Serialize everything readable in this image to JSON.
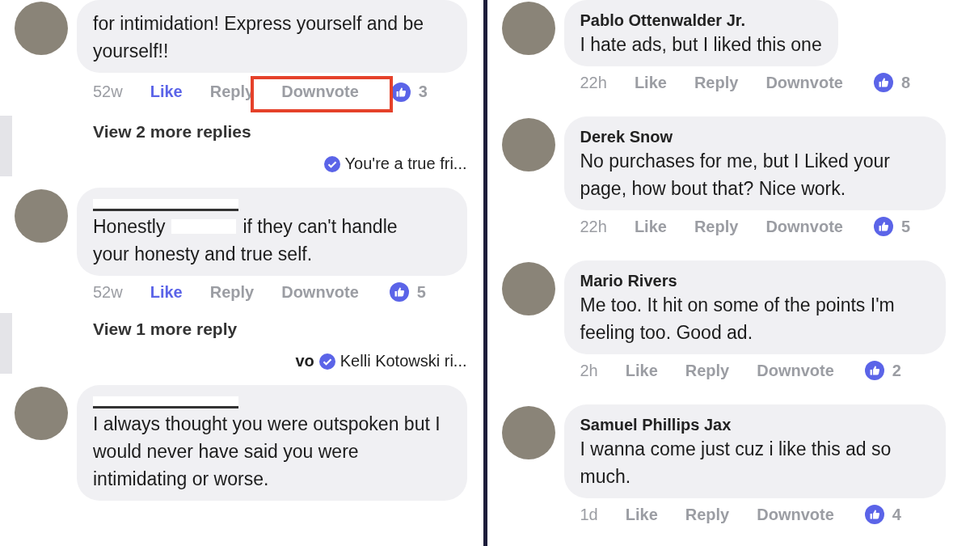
{
  "panels": [
    {
      "comments": [
        {
          "body": [
            {
              "kind": "text",
              "text": "for intimidation! Express yourself and be yourself!!"
            }
          ],
          "time": "52w",
          "like": "Like",
          "liked": true,
          "reply": "Reply",
          "downvote": "Downvote",
          "downvote_highlighted": true,
          "reactions": "3",
          "more_replies": "View 2 more replies",
          "preview": {
            "text": "You're a true fri..."
          }
        },
        {
          "name_redacted": true,
          "body": [
            {
              "kind": "text",
              "text": "Honestly"
            },
            {
              "kind": "redacted"
            },
            {
              "kind": "text",
              "text": "if they can't handle"
            },
            {
              "kind": "text",
              "text": "your honesty and true self."
            }
          ],
          "time": "52w",
          "like": "Like",
          "liked": true,
          "reply": "Reply",
          "downvote": "Downvote",
          "downvote_highlighted": false,
          "reactions": "5",
          "more_replies": "View 1 more reply",
          "preview": {
            "prefix": "vo",
            "text": "Kelli Kotowski ri..."
          }
        },
        {
          "name_redacted": true,
          "body": [
            {
              "kind": "text",
              "text": "I always thought you were outspoken but I would never have said you were intimidating or worse."
            }
          ]
        }
      ]
    },
    {
      "comments": [
        {
          "name": "Pablo Ottenwalder Jr.",
          "body": [
            {
              "kind": "text",
              "text": "I hate ads, but I liked this one"
            }
          ],
          "time": "22h",
          "like": "Like",
          "liked": false,
          "reply": "Reply",
          "downvote": "Downvote",
          "downvote_highlighted": false,
          "reactions": "8"
        },
        {
          "name": "Derek Snow",
          "body": [
            {
              "kind": "text",
              "text": "No purchases for me, but I Liked your page, how bout that? Nice work."
            }
          ],
          "time": "22h",
          "like": "Like",
          "liked": false,
          "reply": "Reply",
          "downvote": "Downvote",
          "downvote_highlighted": false,
          "reactions": "5"
        },
        {
          "name": "Mario Rivers",
          "body": [
            {
              "kind": "text",
              "text": "Me too. It hit on some of the points I'm feeling too. Good ad."
            }
          ],
          "time": "2h",
          "like": "Like",
          "liked": false,
          "reply": "Reply",
          "downvote": "Downvote",
          "downvote_highlighted": false,
          "reactions": "2"
        },
        {
          "name": "Samuel Phillips Jax",
          "body": [
            {
              "kind": "text",
              "text": "I wanna come just cuz i like this ad so much."
            }
          ],
          "time": "1d",
          "like": "Like",
          "liked": false,
          "reply": "Reply",
          "downvote": "Downvote",
          "downvote_highlighted": false,
          "reactions": "4"
        }
      ]
    }
  ]
}
